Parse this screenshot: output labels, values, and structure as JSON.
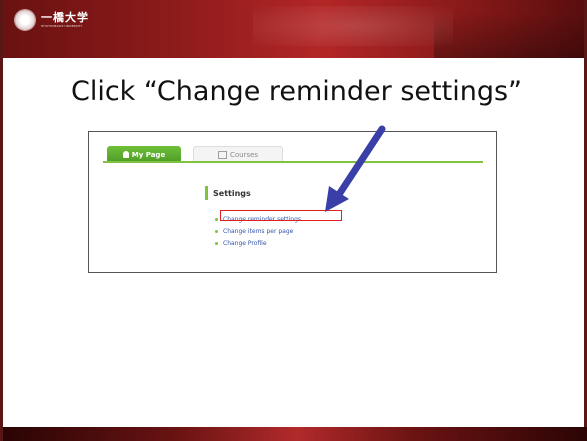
{
  "logo": {
    "main": "一橋大学",
    "sub": "HITOTSUBASHI UNIVERSITY"
  },
  "heading": "Click “Change reminder settings”",
  "screenshot": {
    "tabs": [
      {
        "label": "My Page",
        "icon": "person-icon"
      },
      {
        "label": "Courses",
        "icon": "courses-icon"
      }
    ],
    "settings_title": "Settings",
    "links": [
      "Change reminder settings",
      "Change items per page",
      "Change Profile"
    ]
  },
  "colors": {
    "accent_red": "#b32626",
    "tab_green": "#5aa82e",
    "highlight": "#e02020",
    "arrow": "#3a3fa8"
  }
}
